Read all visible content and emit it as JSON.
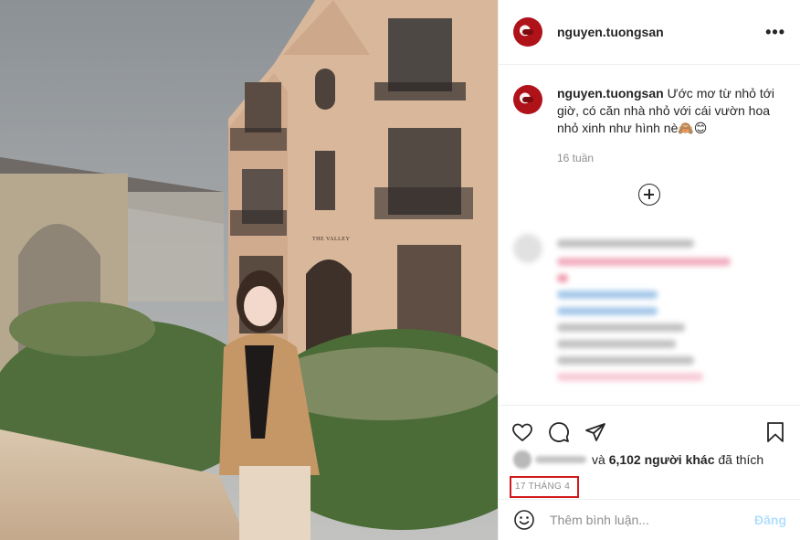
{
  "post": {
    "username": "nguyen.tuongsan",
    "caption": "Ước mơ từ nhỏ tới giờ, có căn nhà nhỏ với cái vườn hoa nhỏ xinh như hình nè🙈😊",
    "time_ago": "16 tuần",
    "likes_suffix": "và",
    "likes_count": "6,102 người khác",
    "likes_tail": "đã thích",
    "date": "17 THÁNG 4",
    "photo_sign": "THE VALLEY"
  },
  "comment_box": {
    "placeholder": "Thêm bình luận...",
    "post_label": "Đăng"
  },
  "icons": {
    "more": "more-options-icon",
    "load_more": "plus-circle-icon",
    "like": "heart-icon",
    "comment": "comment-icon",
    "share": "share-icon",
    "save": "bookmark-icon",
    "emoji": "emoji-icon"
  }
}
